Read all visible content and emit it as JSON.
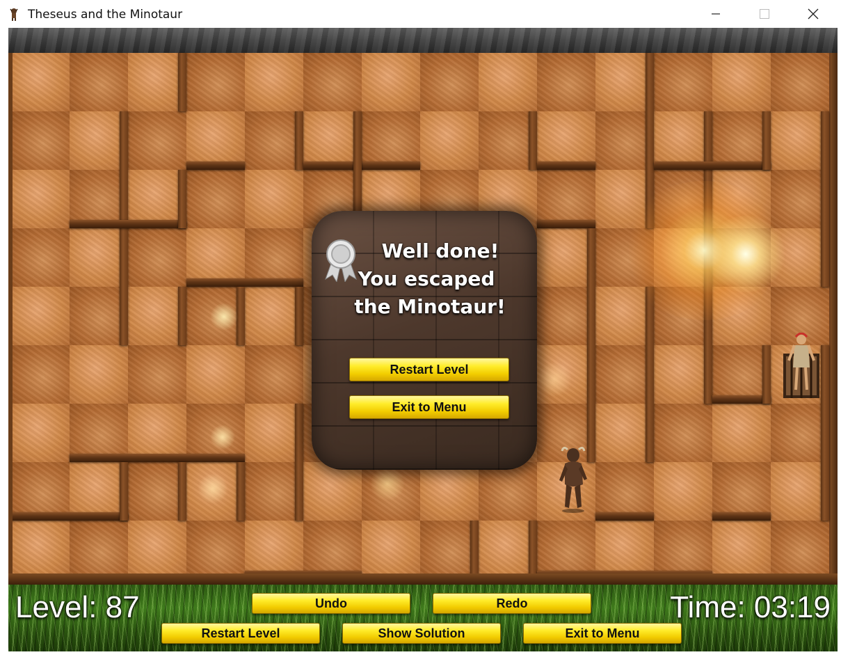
{
  "window": {
    "title": "Theseus and the Minotaur",
    "icon": "minotaur-app-icon",
    "controls": [
      "minimize",
      "maximize",
      "close"
    ]
  },
  "colors": {
    "tile_light": "#d08848",
    "tile_dark": "#b36a32",
    "wall": "#6b3b18",
    "button_gold": "#ffe21a",
    "grass": "#3f7a1c",
    "modal_stone": "#4d382c"
  },
  "modal": {
    "icon": "award-ribbon-icon",
    "lines": [
      "Well done!",
      "You escaped",
      "the Minotaur!"
    ],
    "restart_label": "Restart Level",
    "exit_label": "Exit to Menu"
  },
  "hud": {
    "level_text": "Level: 87",
    "time_text": "Time: 03:19",
    "undo_label": "Undo",
    "redo_label": "Redo",
    "restart_label": "Restart Level",
    "solution_label": "Show Solution",
    "exit_label": "Exit to Menu"
  },
  "characters": {
    "minotaur_icon": "minotaur-icon",
    "theseus_icon": "theseus-icon"
  }
}
